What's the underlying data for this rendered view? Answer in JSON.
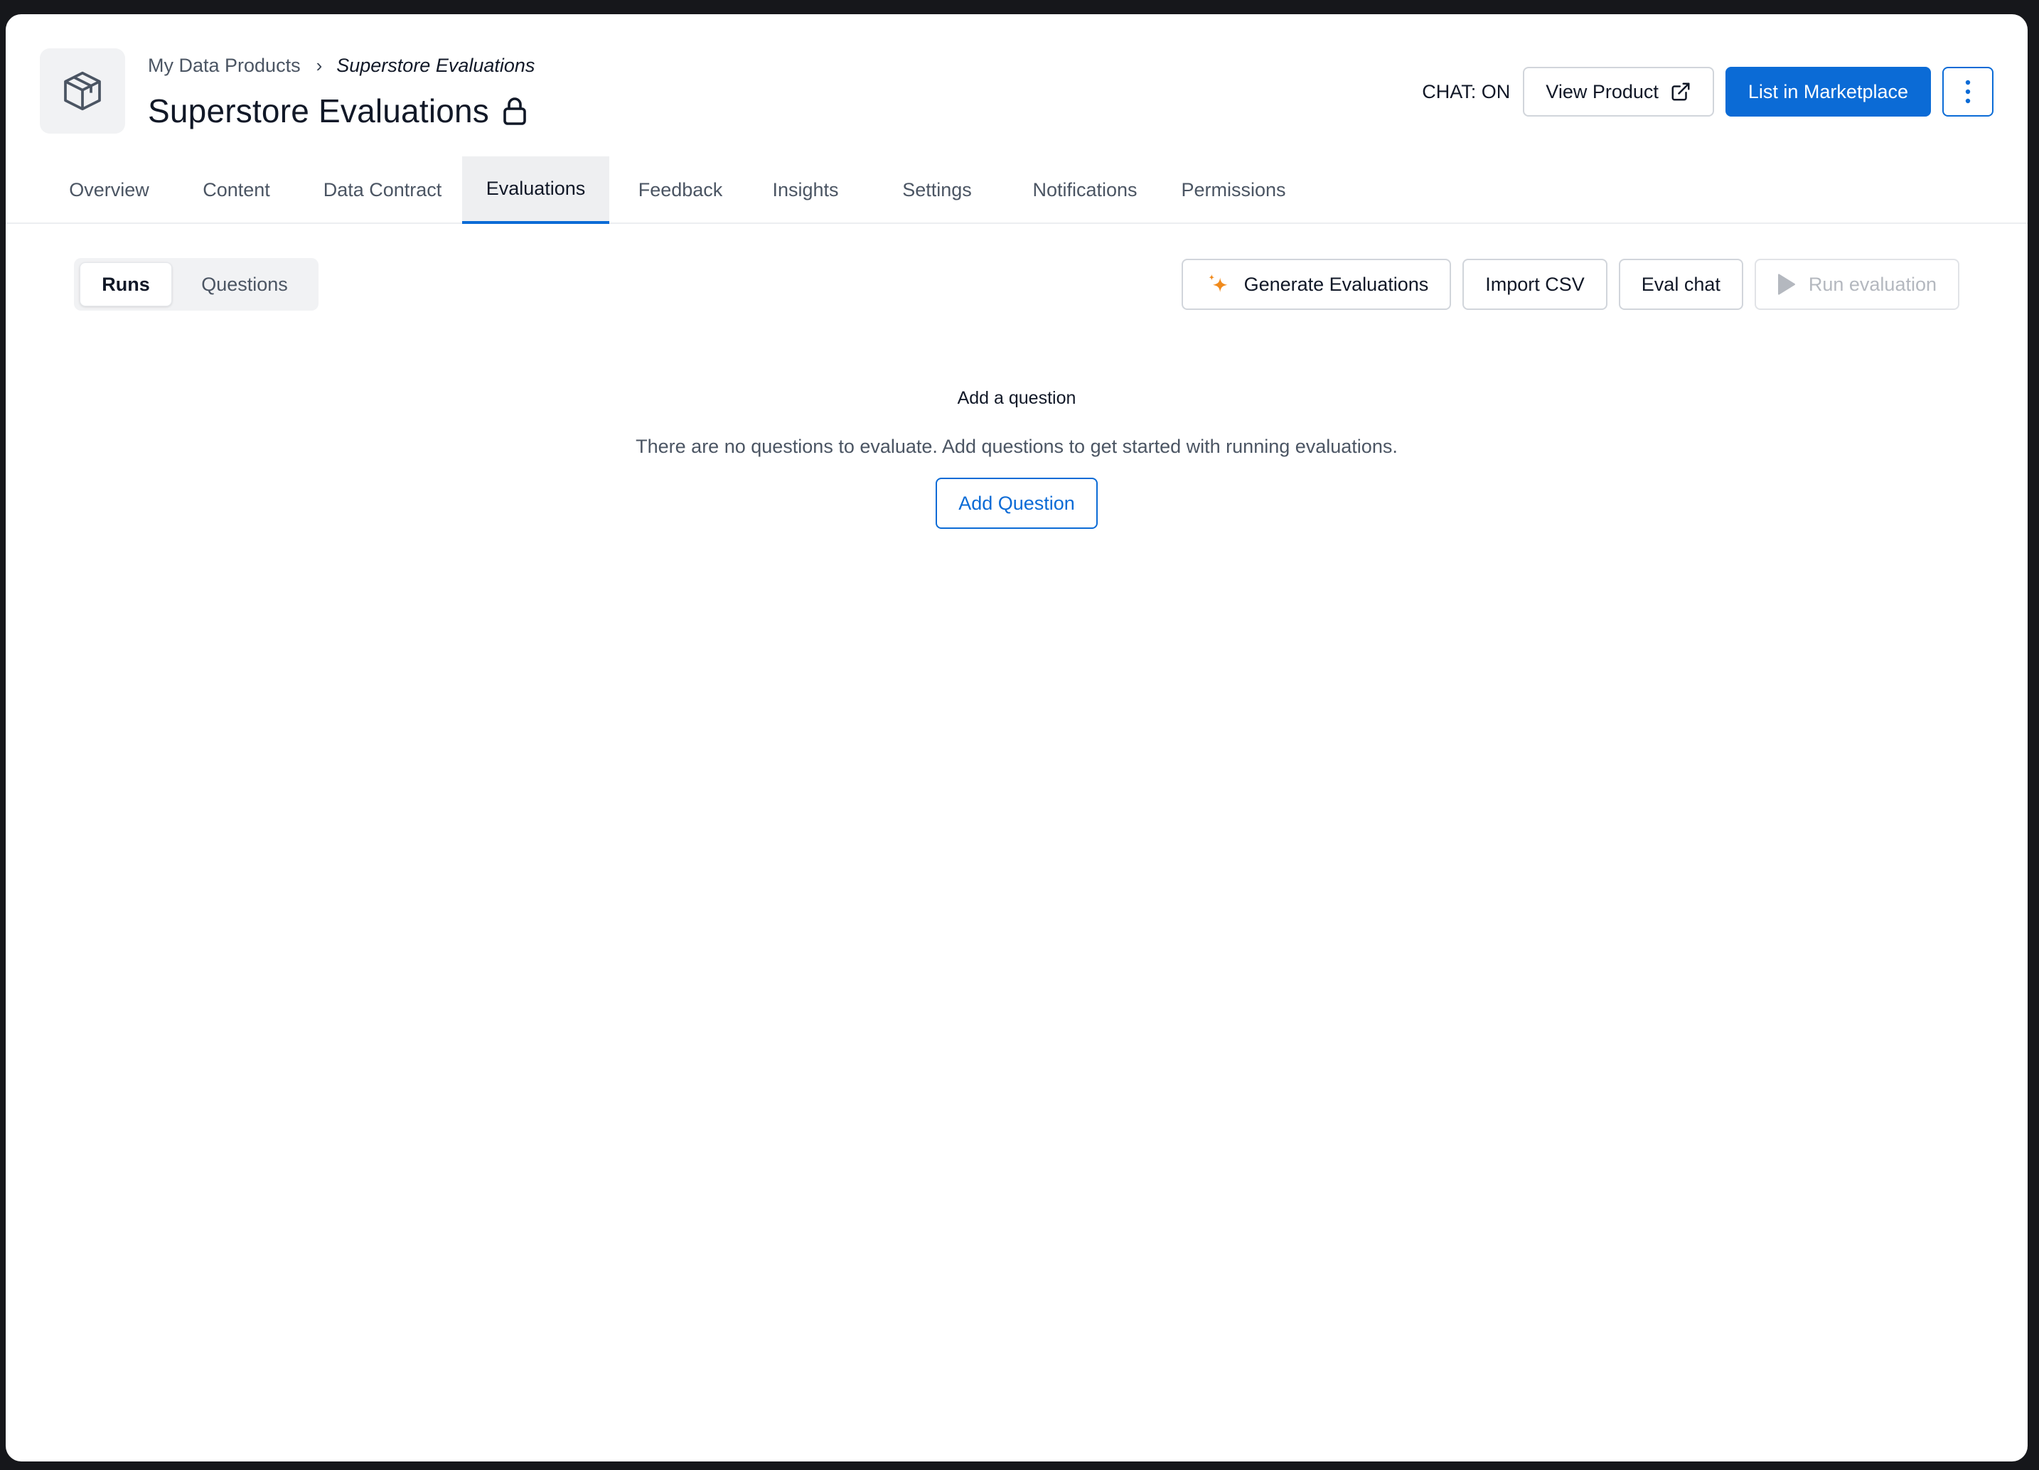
{
  "breadcrumb": {
    "parent": "My Data Products",
    "separator": "›",
    "current": "Superstore Evaluations"
  },
  "page": {
    "title": "Superstore Evaluations",
    "icon": "cube-icon",
    "locked_icon": "lock-icon"
  },
  "header_actions": {
    "chat_status": "CHAT: ON",
    "view_product_label": "View Product",
    "view_product_icon": "external-link-icon",
    "list_marketplace_label": "List in Marketplace",
    "more_icon": "kebab-menu-icon"
  },
  "tabs": [
    {
      "label": "Overview"
    },
    {
      "label": "Content"
    },
    {
      "label": "Data Contract"
    },
    {
      "label": "Evaluations",
      "active": true
    },
    {
      "label": "Feedback"
    },
    {
      "label": "Insights"
    },
    {
      "label": "Settings"
    },
    {
      "label": "Notifications"
    },
    {
      "label": "Permissions"
    }
  ],
  "view_toggle": {
    "runs": "Runs",
    "questions": "Questions",
    "selected": "Runs"
  },
  "toolbar": {
    "generate_label": "Generate Evaluations",
    "generate_icon": "sparkle-icon",
    "import_label": "Import CSV",
    "eval_chat_label": "Eval chat",
    "run_label": "Run evaluation",
    "run_icon": "play-icon",
    "run_disabled": true
  },
  "empty_state": {
    "title": "Add a question",
    "description": "There are no questions to evaluate. Add questions to get started with running evaluations.",
    "button_label": "Add Question"
  },
  "colors": {
    "primary": "#0b6bd6",
    "sparkle": "#f08a1c",
    "active_tab_bg": "#eeeff1"
  }
}
